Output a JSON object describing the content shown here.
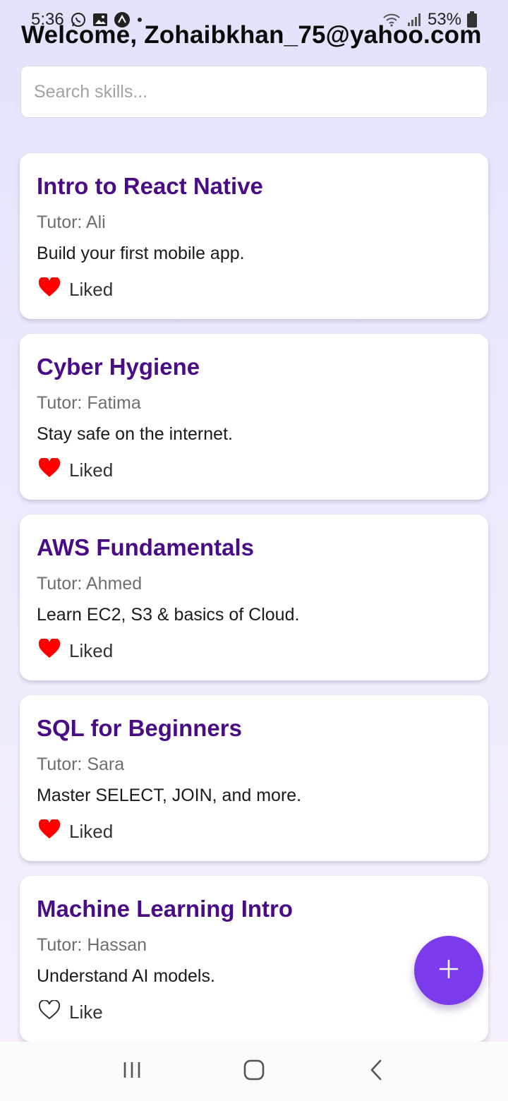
{
  "status_bar": {
    "time": "5:36",
    "battery": "53%",
    "icons": [
      "whatsapp-icon",
      "gallery-icon",
      "expo-icon",
      "dot-icon",
      "wifi-icon",
      "signal-icon",
      "battery-icon"
    ]
  },
  "header": {
    "welcome": "Welcome, Zohaibkhan_75@yahoo.com"
  },
  "search": {
    "placeholder": "Search skills..."
  },
  "skills": [
    {
      "title": "Intro to React Native",
      "tutor": "Tutor: Ali",
      "description": "Build your first mobile app.",
      "like_label": "Liked",
      "liked": true
    },
    {
      "title": "Cyber Hygiene",
      "tutor": "Tutor: Fatima",
      "description": "Stay safe on the internet.",
      "like_label": "Liked",
      "liked": true
    },
    {
      "title": "AWS Fundamentals",
      "tutor": "Tutor: Ahmed",
      "description": "Learn EC2, S3 & basics of Cloud.",
      "like_label": "Liked",
      "liked": true
    },
    {
      "title": "SQL for Beginners",
      "tutor": "Tutor: Sara",
      "description": "Master SELECT, JOIN, and more.",
      "like_label": "Liked",
      "liked": true
    },
    {
      "title": "Machine Learning Intro",
      "tutor": "Tutor: Hassan",
      "description": "Understand AI models.",
      "like_label": "Like",
      "liked": false
    }
  ],
  "fab": {
    "icon": "plus-icon"
  },
  "nav": {
    "icons": [
      "recent-apps-icon",
      "home-icon",
      "back-icon"
    ]
  },
  "colors": {
    "title": "#4a0c85",
    "fab": "#7c3aed",
    "heart": "#ff0000"
  }
}
